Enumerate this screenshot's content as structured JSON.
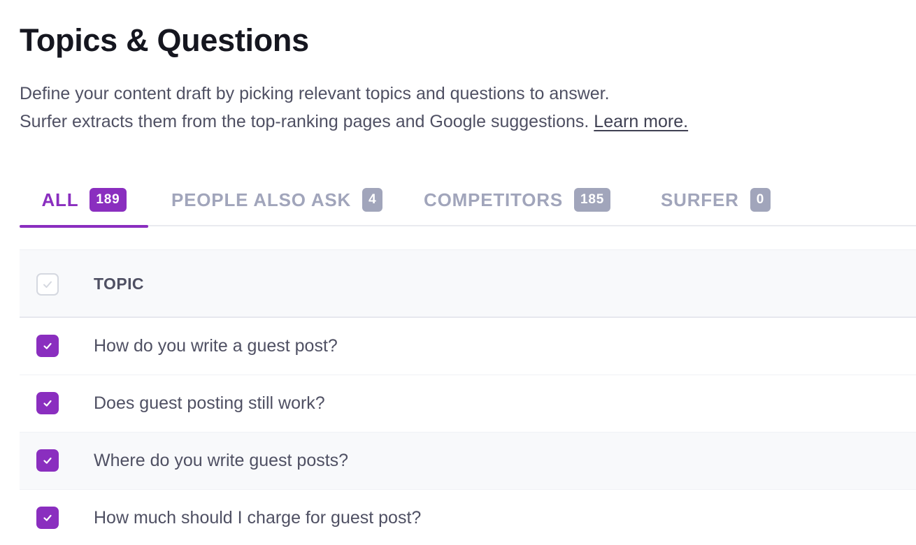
{
  "page": {
    "title": "Topics & Questions",
    "description_line1": "Define your content draft by picking relevant topics and questions to answer.",
    "description_line2": "Surfer extracts them from the top-ranking pages and Google suggestions.",
    "learn_more": "Learn more."
  },
  "tabs": [
    {
      "label": "ALL",
      "count": "189",
      "active": true
    },
    {
      "label": "PEOPLE ALSO ASK",
      "count": "4",
      "active": false
    },
    {
      "label": "COMPETITORS",
      "count": "185",
      "active": false
    },
    {
      "label": "SURFER",
      "count": "0",
      "active": false
    }
  ],
  "table": {
    "header": "TOPIC",
    "rows": [
      {
        "text": "How do you write a guest post?",
        "checked": true
      },
      {
        "text": "Does guest posting still work?",
        "checked": true
      },
      {
        "text": "Where do you write guest posts?",
        "checked": true
      },
      {
        "text": "How much should I charge for guest post?",
        "checked": true
      }
    ]
  },
  "colors": {
    "accent": "#8a2ebf",
    "inactive_tab": "#a1a5bb",
    "text": "#4f5063",
    "title": "#15161f"
  },
  "icons": {
    "checkbox_checked": "check-icon",
    "checkbox_header": "check-icon"
  }
}
